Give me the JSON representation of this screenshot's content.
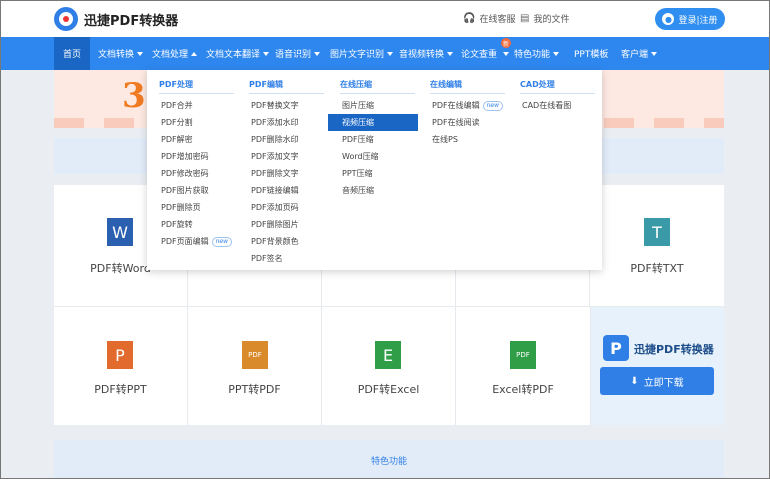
{
  "header": {
    "logo_text": "迅捷PDF转换器",
    "service_label": "在线客服",
    "files_label": "我的文件",
    "login_label": "登录|注册"
  },
  "nav": {
    "items": [
      {
        "label": "首页"
      },
      {
        "label": "文档转换"
      },
      {
        "label": "文档处理"
      },
      {
        "label": "文档文本翻译"
      },
      {
        "label": "语音识别"
      },
      {
        "label": "图片文字识别"
      },
      {
        "label": "音视频转换"
      },
      {
        "label": "论文查重"
      },
      {
        "label": "特色功能"
      },
      {
        "label": "PPT模板"
      },
      {
        "label": "客户端"
      }
    ],
    "new_badge": "新"
  },
  "banner": {
    "big_text": "3"
  },
  "dropdown": {
    "columns": [
      {
        "title": "PDF处理",
        "items": [
          "PDF合并",
          "PDF分割",
          "PDF解密",
          "PDF增加密码",
          "PDF修改密码",
          "PDF图片获取",
          "PDF删除页",
          "PDF旋转",
          "PDF页面编辑"
        ]
      },
      {
        "title": "PDF编辑",
        "items": [
          "PDF替换文字",
          "PDF添加水印",
          "PDF删除水印",
          "PDF添加文字",
          "PDF删除文字",
          "PDF链接编辑",
          "PDF添加页码",
          "PDF删除图片",
          "PDF背景颜色",
          "PDF签名"
        ]
      },
      {
        "title": "在线压缩",
        "items": [
          "图片压缩",
          "视频压缩",
          "PDF压缩",
          "Word压缩",
          "PPT压缩",
          "音频压缩"
        ]
      },
      {
        "title": "在线编辑",
        "items": [
          "PDF在线编辑",
          "PDF在线阅读",
          "在线PS"
        ]
      },
      {
        "title": "CAD处理",
        "items": [
          "CAD在线看图"
        ]
      }
    ],
    "new_badge": "new"
  },
  "grid": {
    "cells": [
      {
        "label": "PDF转Word",
        "icon": "W"
      },
      {
        "label": "PDF转TXT",
        "icon": "T"
      },
      {
        "label": "PDF转PPT",
        "icon": "P"
      },
      {
        "label": "PPT转PDF",
        "icon": "PDF"
      },
      {
        "label": "PDF转Excel",
        "icon": "E"
      },
      {
        "label": "Excel转PDF",
        "icon": "PDF"
      }
    ],
    "promo_title": "迅捷PDF转换器",
    "download_label": "立即下载"
  },
  "feature_label": "特色功能",
  "colors": {
    "primary": "#2e87ee",
    "nav_active": "#1a66c4",
    "word": "#2b5fb0",
    "txt": "#3a9aa8",
    "ppt": "#e26a2c",
    "pdf": "#d98a2b",
    "excel": "#2f9e47"
  }
}
